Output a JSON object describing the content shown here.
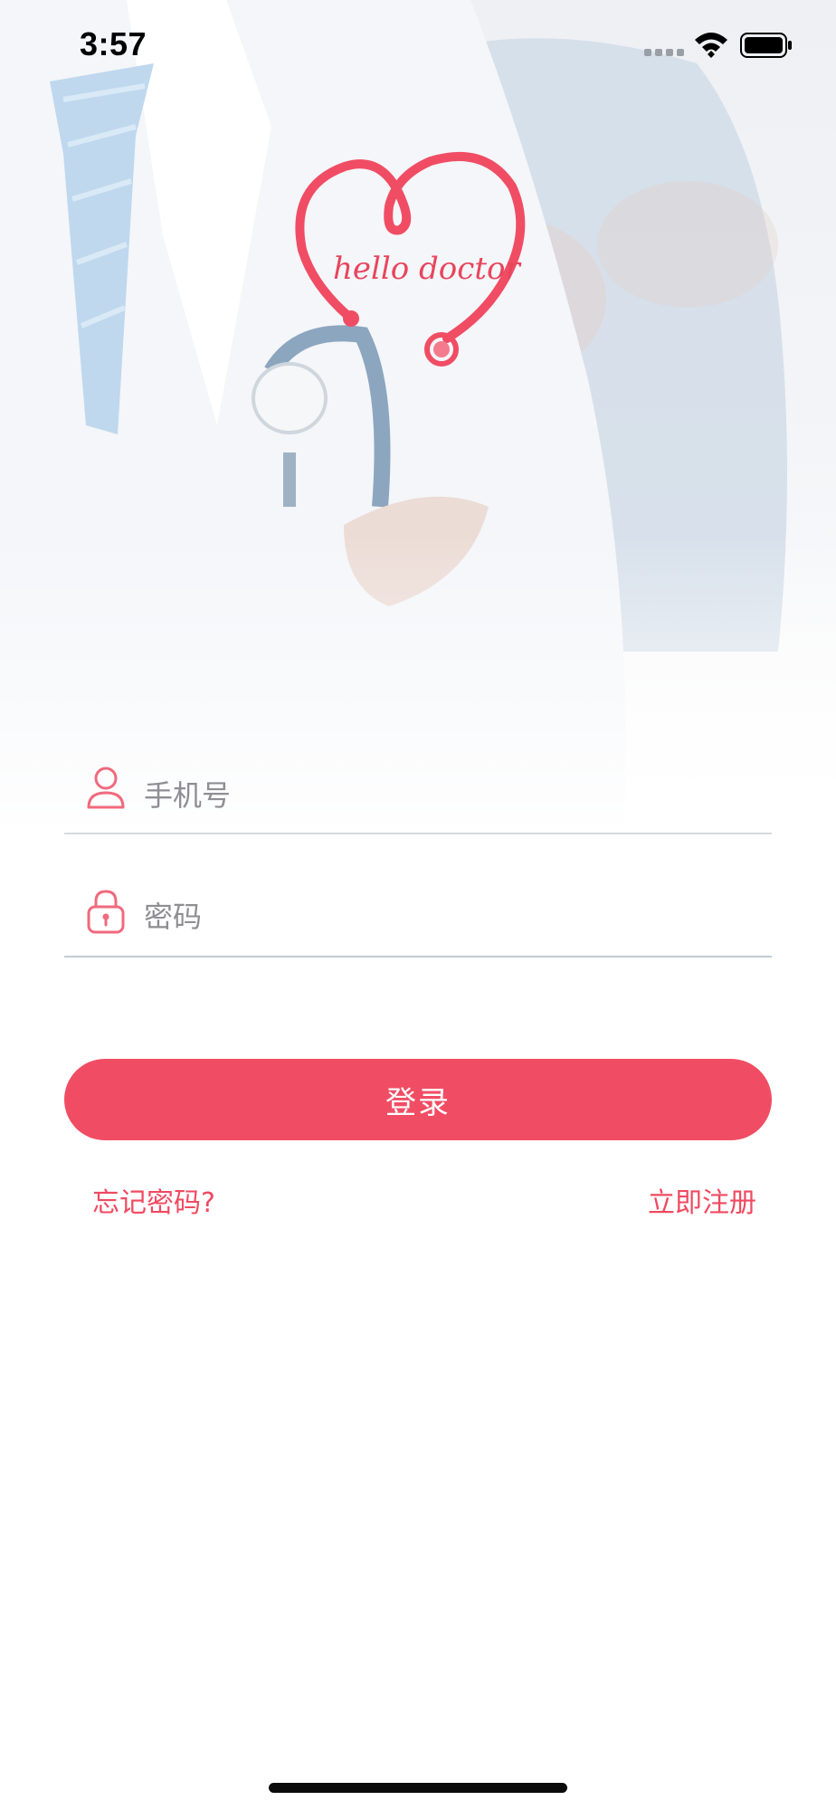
{
  "status_bar": {
    "time": "3:57",
    "signal_icon": "cellular-signal-icon",
    "wifi_icon": "wifi-icon",
    "battery_icon": "battery-icon"
  },
  "hero": {
    "background": "doctor-with-stethoscope-photo",
    "logo_text": "hello doctor",
    "logo_icon": "heart-stethoscope-logo-icon"
  },
  "form": {
    "phone": {
      "placeholder": "手机号",
      "value": "",
      "icon": "user-icon"
    },
    "password": {
      "placeholder": "密码",
      "value": "",
      "icon": "lock-icon"
    }
  },
  "actions": {
    "login_label": "登录",
    "forgot_password_label": "忘记密码?",
    "register_label": "立即注册"
  },
  "colors": {
    "accent": "#f04d64",
    "link": "#ef4a61",
    "placeholder": "#8e8e93",
    "divider": "#d5dadf"
  }
}
